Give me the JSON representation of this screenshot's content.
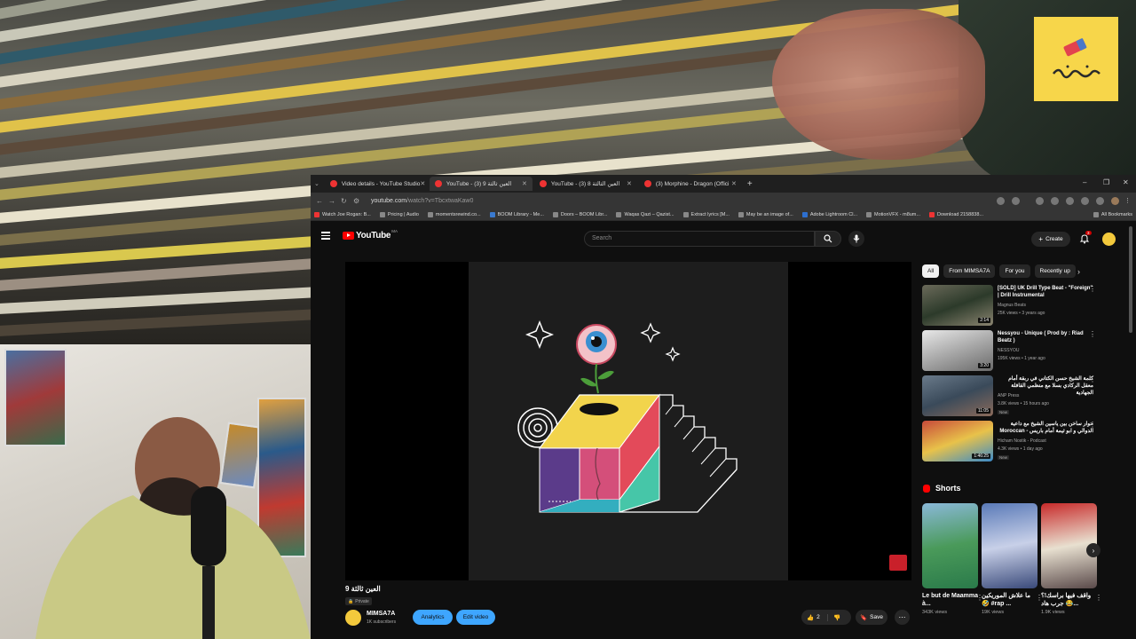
{
  "browser": {
    "tabs": [
      {
        "label": "Video details - YouTube Studio",
        "active": false
      },
      {
        "label": "YouTube - (3) العين ثالثة 9",
        "active": true
      },
      {
        "label": "YouTube - (3) العين الثالثة 8",
        "active": false
      },
      {
        "label": "(3) Morphine - Dragon (Offici",
        "active": false
      }
    ],
    "url_host": "youtube.com",
    "url_path": "/watch?v=TbcxtwaKaw0",
    "bookmarks": [
      "Watch Joe Rogan: B...",
      "Pricing | Audio",
      "momentsrewind.co...",
      "BOOM Library - Me...",
      "Doors – BOOM Libr...",
      "Waqas Qazi – Qazist...",
      "Extract lyrics [M...",
      "May be an image of...",
      "Adobe Lightroom Cl...",
      "MotionVFX - m8um...",
      "Download 2158838..."
    ],
    "all_bookmarks": "All Bookmarks"
  },
  "yt": {
    "logo_text": "YouTube",
    "country": "MA",
    "search_placeholder": "Search",
    "create_label": "Create",
    "notif_count": "3"
  },
  "video": {
    "title": "العين ثالثة 9",
    "privacy": "Private",
    "channel": "MIMSA7A",
    "subscribers": "1K subscribers",
    "analytics_label": "Analytics",
    "edit_label": "Edit video",
    "likes": "2",
    "save_label": "Save"
  },
  "sidebar": {
    "chips": [
      "All",
      "From MIMSA7A",
      "For you",
      "Recently up"
    ],
    "recs": [
      {
        "title": "[SOLD] UK Drill Type Beat - \"Foreign\" | Drill Instrumental",
        "channel": "Magnus Beats",
        "meta": "25K views • 3 years ago",
        "duration": "2:14",
        "new": ""
      },
      {
        "title": "Nessyou - Unique ( Prod by : Riad Beatz )",
        "channel": "NESSYOU",
        "meta": "195K views • 1 year ago",
        "duration": "3:20",
        "new": ""
      },
      {
        "title": "كلمة الشيخ حسن الكتاني في ربقة أمام معقل الركادي بسلا مع منظمي القافلة الجهادية",
        "channel": "ANP Press",
        "meta": "3.8K views • 15 hours ago",
        "duration": "11:05",
        "new": "New"
      },
      {
        "title": "حوار ساخن بين ياسين الشيخ مع داعية الدوالي و ابو ثيمة أمام باريس - Moroccan",
        "channel": "Hicham Nostik - Podcast",
        "meta": "4.3K views • 1 day ago",
        "duration": "1:46:25",
        "new": "New"
      }
    ],
    "shorts_heading": "Shorts",
    "shorts": [
      {
        "title": "Le but de Maamma à...",
        "views": "343K views"
      },
      {
        "title": "ما علاش الموريكين 🤣 #rap ...",
        "views": "19K views"
      },
      {
        "title": "واقف فيها براسك!؟ 😂 جرب هاد...",
        "views": "1.9K views"
      }
    ]
  },
  "colors": {
    "accent": "#3ea6ff",
    "yt_red": "#ff0000",
    "logo_yellow": "#f7d64a",
    "bg": "#0f0f0f"
  }
}
